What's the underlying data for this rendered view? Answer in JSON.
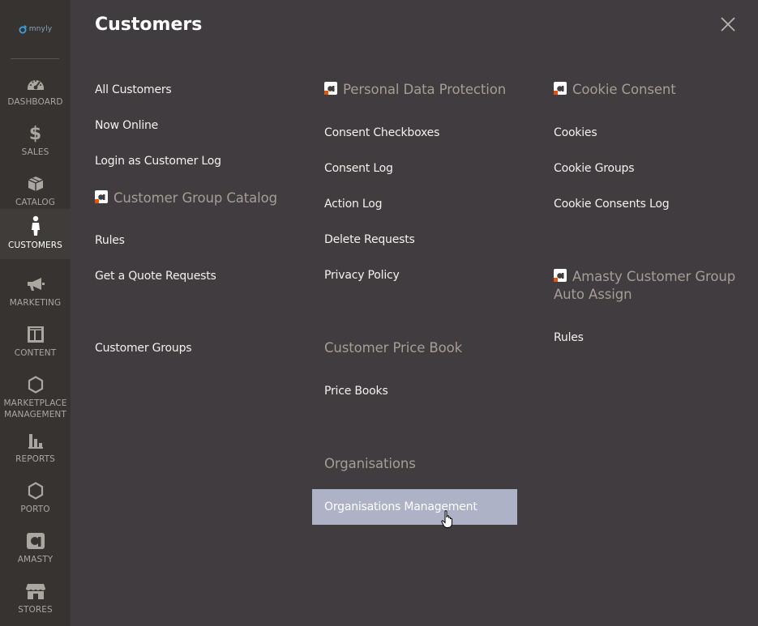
{
  "logo": {
    "text": "mnyly"
  },
  "nav": [
    {
      "label": "DASHBOARD",
      "icon": "dashboard-icon"
    },
    {
      "label": "SALES",
      "icon": "dollar-icon"
    },
    {
      "label": "CATALOG",
      "icon": "box-icon"
    },
    {
      "label": "CUSTOMERS",
      "icon": "person-icon",
      "active": true
    },
    {
      "label": "MARKETING",
      "icon": "megaphone-icon"
    },
    {
      "label": "CONTENT",
      "icon": "layout-icon"
    },
    {
      "label": "MARKETPLACE MANAGEMENT",
      "icon": "hexagon-icon"
    },
    {
      "label": "REPORTS",
      "icon": "bar-chart-icon"
    },
    {
      "label": "PORTO",
      "icon": "hexagon-icon"
    },
    {
      "label": "AMASTY",
      "icon": "amasty-icon"
    },
    {
      "label": "STORES",
      "icon": "store-icon"
    }
  ],
  "panel": {
    "title": "Customers",
    "col1": {
      "links": [
        "All Customers",
        "Now Online",
        "Login as Customer Log"
      ],
      "section": "Customer Group Catalog",
      "section_links": [
        "Rules",
        "Get a Quote Requests"
      ],
      "extra_link": "Customer Groups"
    },
    "col2": {
      "section1": "Personal Data Protection",
      "section1_links": [
        "Consent Checkboxes",
        "Consent Log",
        "Action Log",
        "Delete Requests",
        "Privacy Policy"
      ],
      "section2": "Customer Price Book",
      "section2_links": [
        "Price Books"
      ],
      "section3": "Organisations",
      "section3_links": [
        "Organisations Management"
      ]
    },
    "col3": {
      "section1": "Cookie Consent",
      "section1_links": [
        "Cookies",
        "Cookie Groups",
        "Cookie Consents Log"
      ],
      "section2_line1": "Amasty Customer Group",
      "section2_line2": "Auto Assign",
      "section2_links": [
        "Rules"
      ]
    }
  },
  "colors": {
    "sidebar_bg": "#373330",
    "panel_bg": "#403c3f",
    "hover_bg": "#adb2c6",
    "section_head": "#a79d95",
    "amasty_accent": "#eb5202"
  }
}
